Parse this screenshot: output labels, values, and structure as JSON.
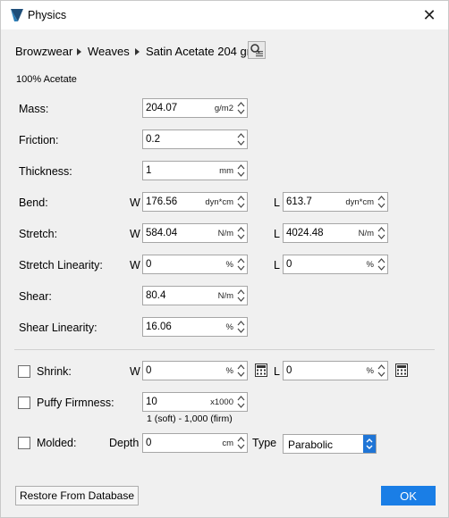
{
  "window": {
    "title": "Physics",
    "close_symbol": "✕"
  },
  "breadcrumb": [
    "Browzwear",
    "Weaves",
    "Satin Acetate 204 gr"
  ],
  "material_desc": "100% Acetate",
  "side_labels": {
    "w": "W",
    "l": "L"
  },
  "rows": {
    "mass": {
      "label": "Mass:",
      "value": "204.07",
      "unit": "g/m2"
    },
    "friction": {
      "label": "Friction:",
      "value": "0.2",
      "unit": ""
    },
    "thickness": {
      "label": "Thickness:",
      "value": "1",
      "unit": "mm"
    },
    "bend": {
      "label": "Bend:",
      "w": {
        "value": "176.56",
        "unit": "dyn*cm"
      },
      "l": {
        "value": "613.7",
        "unit": "dyn*cm"
      }
    },
    "stretch": {
      "label": "Stretch:",
      "w": {
        "value": "584.04",
        "unit": "N/m"
      },
      "l": {
        "value": "4024.48",
        "unit": "N/m"
      }
    },
    "stretch_linearity": {
      "label": "Stretch Linearity:",
      "w": {
        "value": "0",
        "unit": "%"
      },
      "l": {
        "value": "0",
        "unit": "%"
      }
    },
    "shear": {
      "label": "Shear:",
      "value": "80.4",
      "unit": "N/m"
    },
    "shear_linearity": {
      "label": "Shear Linearity:",
      "value": "16.06",
      "unit": "%"
    }
  },
  "shrink": {
    "label": "Shrink:",
    "w": {
      "value": "0",
      "unit": "%"
    },
    "l": {
      "value": "0",
      "unit": "%"
    }
  },
  "puffy": {
    "label": "Puffy Firmness:",
    "value": "10",
    "unit": "x1000",
    "range_note": "1 (soft) - 1,000 (firm)"
  },
  "molded": {
    "label": "Molded:",
    "depth_label": "Depth",
    "depth_value": "0",
    "depth_unit": "cm",
    "type_label": "Type",
    "type_value": "Parabolic"
  },
  "buttons": {
    "restore": "Restore From Database",
    "ok": "OK"
  },
  "colors": {
    "accent": "#1a7ee6",
    "window_bg": "#f0f0f0"
  }
}
